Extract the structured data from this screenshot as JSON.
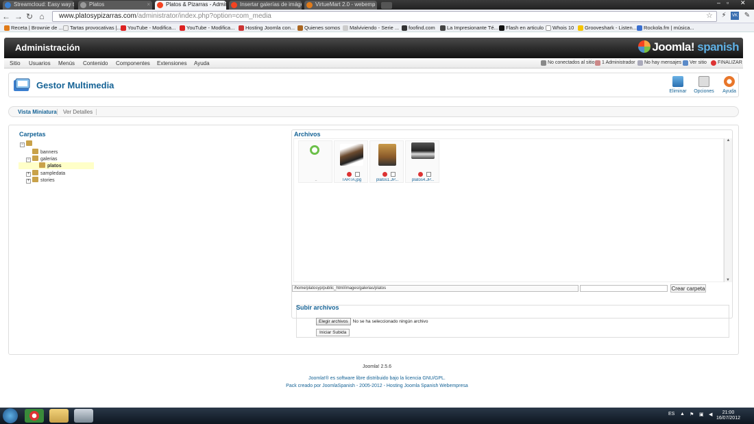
{
  "browser": {
    "tabs": [
      {
        "title": "Streamcloud: Easy way to s",
        "active": false
      },
      {
        "title": "Platos",
        "active": false
      },
      {
        "title": "Platos & Pizarras - Admin",
        "active": true
      },
      {
        "title": "Insertar galerías de imágen",
        "active": false
      },
      {
        "title": "VirtueMart 2.0 - webemp",
        "active": false
      }
    ],
    "url_host": "www.platosypizarras.com",
    "url_path": "/administrator/index.php?option=com_media",
    "bookmarks": [
      "Receta | Brownie de ...",
      "Tartas provocativas |...",
      "YouTube - Modifica...",
      "YouTube - Modifica...",
      "Hosting Joomla con...",
      "Quienes somos",
      "Malviviendo - Serie ...",
      "foofind.com",
      "La Impresionante Té...",
      "Flash en articulo",
      "Whois 10",
      "Grooveshark - Listen...",
      "Rockola.fm | música..."
    ]
  },
  "admin": {
    "title": "Administración",
    "logo": "Joomla!",
    "logo_suffix": "spanish",
    "menu": [
      "Sitio",
      "Usuarios",
      "Menús",
      "Contenido",
      "Componentes",
      "Extensiones",
      "Ayuda"
    ],
    "status": {
      "visitors": "No conectados al sitio",
      "admins": "1 Administrador",
      "messages": "No hay mensajes",
      "view_site": "Ver sitio",
      "logout": "FINALIZAR"
    },
    "page_title": "Gestor Multimedia",
    "toolbar": {
      "delete": "Eliminar",
      "options": "Opciones",
      "help": "Ayuda"
    },
    "view_tabs": [
      "Vista Miniatura",
      "Ver Detalles"
    ]
  },
  "media": {
    "folders_title": "Carpetas",
    "folders": [
      {
        "name": "banners",
        "level": 1
      },
      {
        "name": "galerias",
        "level": 1
      },
      {
        "name": "platos",
        "level": 2,
        "selected": true
      },
      {
        "name": "sampledata",
        "level": 1
      },
      {
        "name": "stories",
        "level": 1
      }
    ],
    "files_title": "Archivos",
    "files": [
      {
        "name": "..",
        "type": "up"
      },
      {
        "name": "TARTA.jpg",
        "type": "image",
        "color": "#6b4a2e"
      },
      {
        "name": "platos1.JP...",
        "type": "image",
        "color": "#b8843a"
      },
      {
        "name": "platos4.JP...",
        "type": "image",
        "color": "#444444"
      }
    ],
    "path": "/home/platosyp/public_html/images/galerias/platos",
    "folder_input": "",
    "create_folder": "Crear carpeta",
    "upload_title": "Subir archivos",
    "choose_files": "Elegir archivos",
    "no_file": "No se ha seleccionado ningún archivo",
    "start_upload": "Iniciar Subida"
  },
  "footer": {
    "version": "Joomla! 2.5.6",
    "license_link": "Joomla!®",
    "license_text": " es software libre distribuido bajo la licencia GNU/GPL.",
    "pack": "Pack creado por JoomlaSpanish - 2005-2012 - Hosting Joomla Spanish Webempresa"
  },
  "taskbar": {
    "lang": "ES",
    "time": "21:00",
    "date": "16/07/2012"
  },
  "colors": {
    "accent": "#146295",
    "joomla_blue": "#5fb0e4"
  }
}
